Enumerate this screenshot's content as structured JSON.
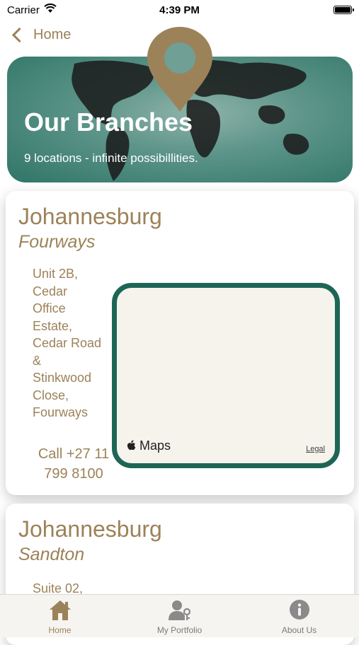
{
  "status_bar": {
    "carrier": "Carrier",
    "time": "4:39 PM"
  },
  "nav": {
    "back_label": "Home"
  },
  "hero": {
    "title": "Our Branches",
    "subtitle": "9 locations - infinite possibillities."
  },
  "branches": [
    {
      "city": "Johannesburg",
      "suburb": "Fourways",
      "address_lines": [
        "Unit 2B,",
        "Cedar",
        "Office",
        "Estate,",
        "Cedar Road",
        "&",
        "Stinkwood",
        "Close,",
        "Fourways"
      ],
      "phone_lines": [
        "Call +27 11",
        "799 8100"
      ],
      "map": {
        "attribution": "Maps",
        "legal": "Legal"
      }
    },
    {
      "city": "Johannesburg",
      "suburb": "Sandton",
      "address_first_line": "Suite 02,"
    }
  ],
  "tabs": [
    {
      "label": "Home",
      "icon": "home-icon",
      "active": true
    },
    {
      "label": "My Portfolio",
      "icon": "portfolio-icon",
      "active": false
    },
    {
      "label": "About Us",
      "icon": "info-icon",
      "active": false
    }
  ],
  "colors": {
    "accent": "#9c8259",
    "map_border": "#1d6656",
    "hero_green": "#2f7567"
  }
}
